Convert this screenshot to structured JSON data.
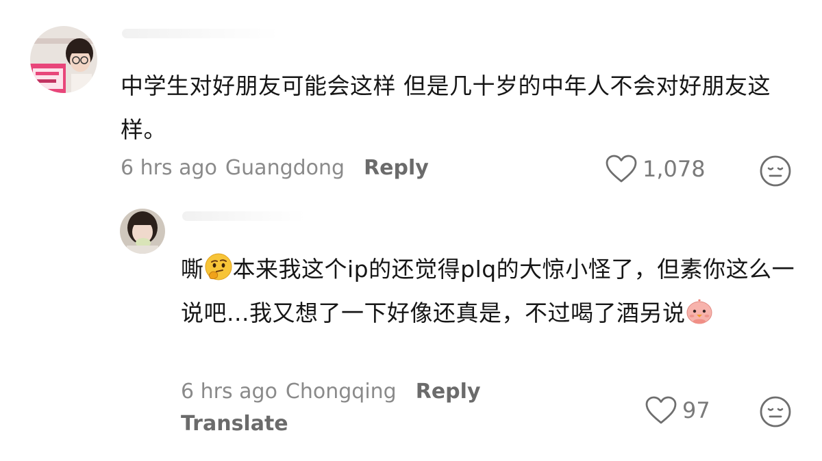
{
  "comment1": {
    "text": "中学生对好朋友可能会这样 但是几十岁的中年人不会对好朋友这样。",
    "time": "6 hrs ago",
    "location": "Guangdong",
    "reply_label": "Reply",
    "like_count": "1,078",
    "icons": {
      "avatar": "avatar-girl-glasses",
      "like": "heart-outline-icon",
      "dislike": "meh-face-icon"
    },
    "avatar_sign_text": "爱学习的女孩最有出息"
  },
  "comment2": {
    "text_part1": "嘶",
    "text_part2": "本来我这个ip的还觉得plq的大惊小怪了，但素你这么一说吧...我又想了一下好像还真是，不过喝了酒另说",
    "time": "6 hrs ago",
    "location": "Chongqing",
    "reply_label": "Reply",
    "translate_label": "Translate",
    "like_count": "97",
    "icons": {
      "avatar": "avatar-girl-drinking",
      "emoji_1": "thinking-face-emoji",
      "emoji_2": "pink-chick-emoji",
      "like": "heart-outline-icon",
      "dislike": "meh-face-icon"
    }
  },
  "colors": {
    "text": "#161616",
    "meta": "#8a8a8a",
    "reply": "#6b6b6b",
    "icon": "#6e6e6e"
  }
}
